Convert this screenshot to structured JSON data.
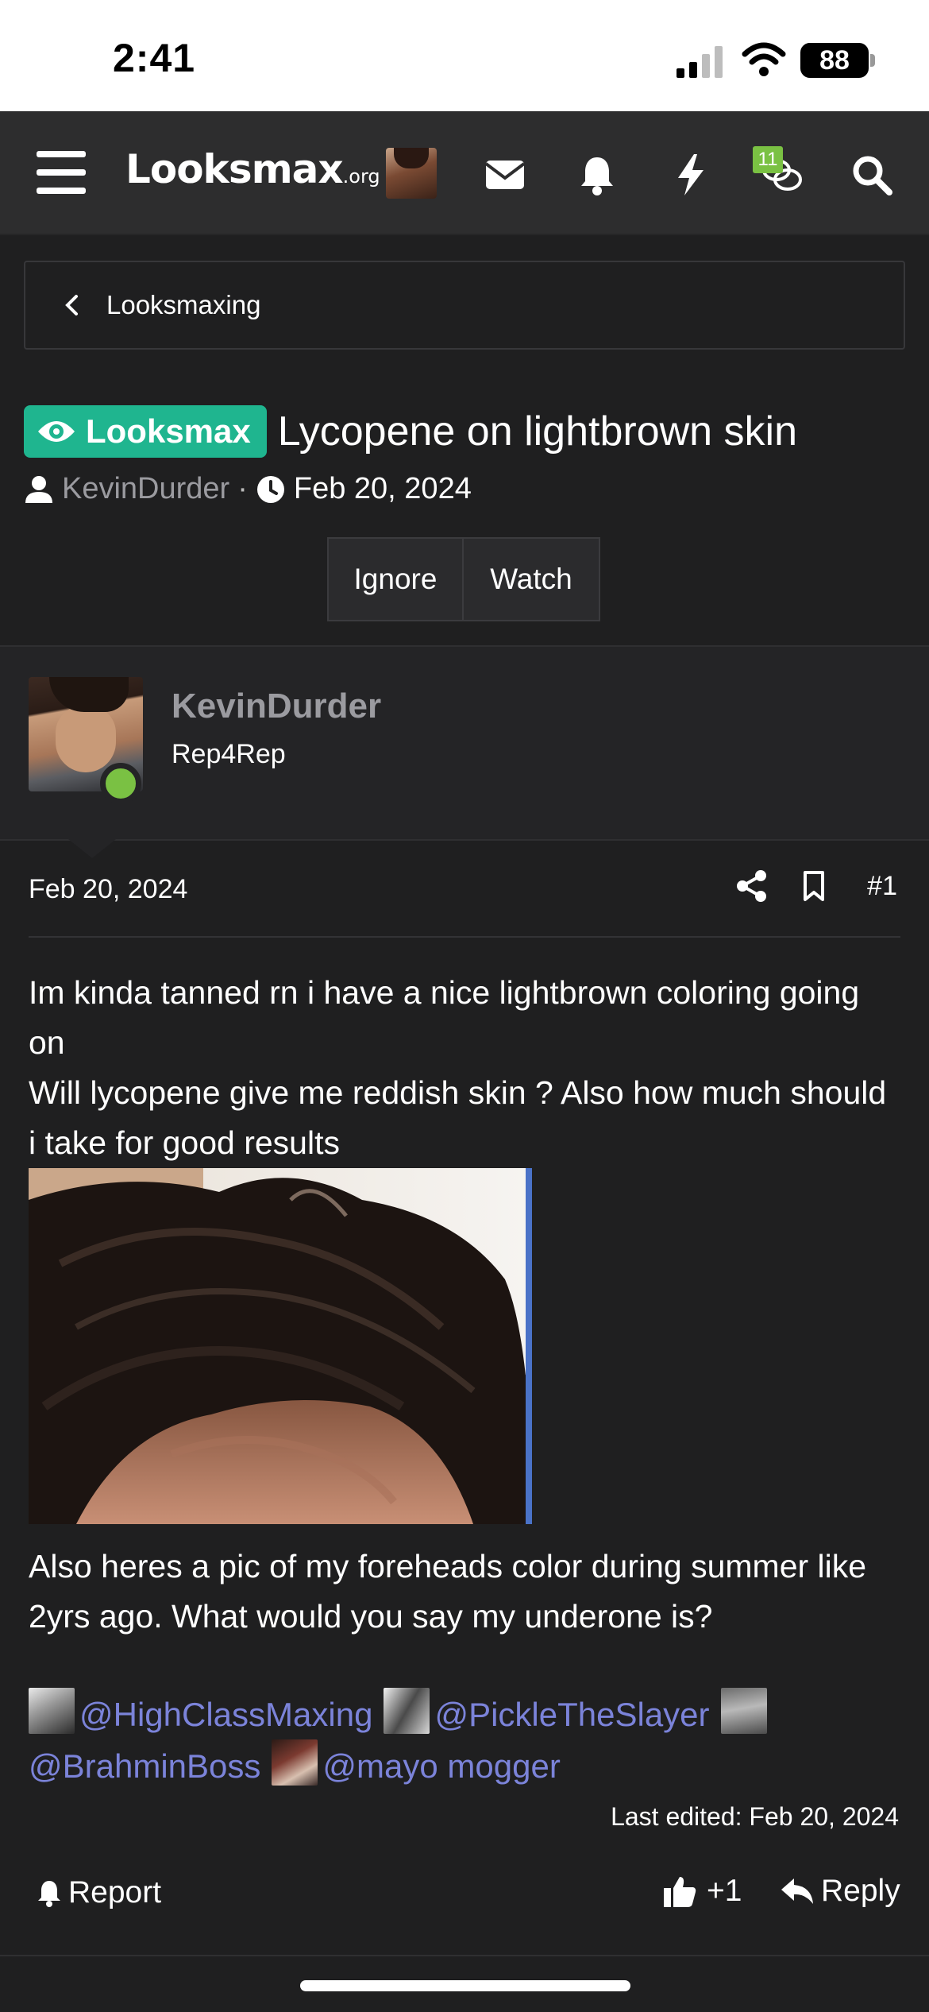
{
  "status_bar": {
    "time": "2:41",
    "battery": "88"
  },
  "nav": {
    "logo_main": "Looksmax",
    "logo_suffix": ".org",
    "conversations_badge": "11",
    "icons": [
      "menu-icon",
      "avatar",
      "mail-icon",
      "bell-icon",
      "bolt-icon",
      "chat-icon",
      "search-icon"
    ]
  },
  "breadcrumb": {
    "label": "Looksmaxing"
  },
  "thread": {
    "prefix": "Looksmax",
    "title": "Lycopene on lightbrown skin",
    "author": "KevinDurder",
    "separator": "·",
    "date": "Feb 20, 2024",
    "ignore_label": "Ignore",
    "watch_label": "Watch"
  },
  "post": {
    "username": "KevinDurder",
    "user_title": "Rep4Rep",
    "date": "Feb 20, 2024",
    "number": "#1",
    "text_1": "Im kinda tanned rn i have a nice lightbrown coloring going on",
    "text_2": "Will lycopene give me reddish skin ? Also how much should i take for good results",
    "text_3": "Also heres a pic of my foreheads color during summer like 2yrs ago. What would you say my underone is?",
    "mentions": [
      "@HighClassMaxing",
      "@PickleTheSlayer",
      "@BrahminBoss",
      "@mayo mogger"
    ],
    "last_edited": "Last edited: Feb 20, 2024",
    "report_label": "Report",
    "like_label": "+1",
    "reply_label": "Reply"
  },
  "colors": {
    "background": "#1f1f20",
    "nav_bg": "#2d2d2e",
    "prefix_green": "#1fb58f",
    "online_green": "#7ac143",
    "mention_blue": "#7b83d9",
    "username_gray": "#9b9ba0"
  }
}
